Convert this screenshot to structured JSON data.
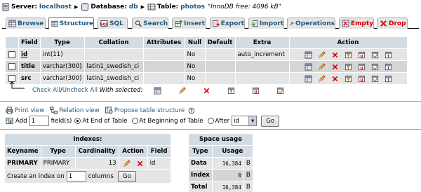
{
  "breadcrumb": {
    "server_label": "Server:",
    "server": "localhost",
    "db_label": "Database:",
    "db": "db",
    "table_label": "Table:",
    "table": "photos",
    "comment": "\"InnoDB free: 4096 kB\""
  },
  "tabs": [
    {
      "label": "Browse"
    },
    {
      "label": "Structure"
    },
    {
      "label": "SQL"
    },
    {
      "label": "Search"
    },
    {
      "label": "Insert"
    },
    {
      "label": "Export"
    },
    {
      "label": "Import"
    },
    {
      "label": "Operations"
    },
    {
      "label": "Empty"
    },
    {
      "label": "Drop"
    }
  ],
  "structure": {
    "headers": [
      "Field",
      "Type",
      "Collation",
      "Attributes",
      "Null",
      "Default",
      "Extra",
      "Action"
    ],
    "rows": [
      {
        "field": "id",
        "type": "int(11)",
        "collation": "",
        "attributes": "",
        "null": "No",
        "default": "",
        "extra": "auto_increment"
      },
      {
        "field": "title",
        "type": "varchar(300)",
        "collation": "latin1_swedish_ci",
        "attributes": "",
        "null": "No",
        "default": "",
        "extra": ""
      },
      {
        "field": "src",
        "type": "varchar(300)",
        "collation": "latin1_swedish_ci",
        "attributes": "",
        "null": "No",
        "default": "",
        "extra": ""
      }
    ]
  },
  "checkall": {
    "check": "Check All",
    "slash": " / ",
    "uncheck": "Uncheck All",
    "with_selected": "With selected:"
  },
  "links": {
    "print": "Print view",
    "relation": "Relation view",
    "propose": "Propose table structure"
  },
  "add_field": {
    "add": "Add",
    "count": "1",
    "fields_label": "field(s)",
    "opt_end": "At End of Table",
    "opt_begin": "At Beginning of Table",
    "opt_after": "After",
    "after_value": "id",
    "go": "Go"
  },
  "indexes": {
    "title": "Indexes:",
    "headers": [
      "Keyname",
      "Type",
      "Cardinality",
      "Action",
      "Field"
    ],
    "rows": [
      {
        "keyname": "PRIMARY",
        "type": "PRIMARY",
        "cardinality": "13",
        "field": "id"
      }
    ],
    "create_prefix": "Create an index on",
    "create_value": "1",
    "create_suffix": "columns",
    "go": "Go"
  },
  "space": {
    "title": "Space usage",
    "headers": [
      "Type",
      "Usage"
    ],
    "rows": [
      {
        "type": "Data",
        "usage": "16,384",
        "unit": "B"
      },
      {
        "type": "Index",
        "usage": "0",
        "unit": "B"
      },
      {
        "type": "Total",
        "usage": "16,384",
        "unit": "B"
      }
    ]
  },
  "colors": {
    "link": "#235a81",
    "header_bg": "#d3dce3",
    "row_light": "#e5e5e5",
    "row_dark": "#d5d5d5",
    "danger": "#cc0000"
  }
}
